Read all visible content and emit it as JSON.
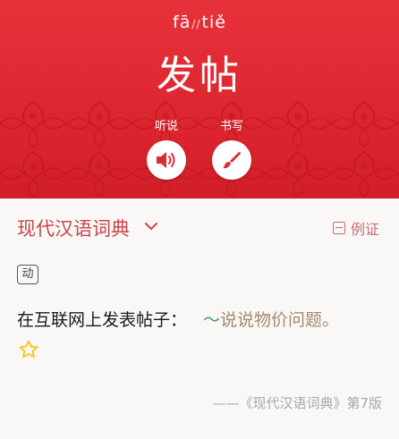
{
  "entry": {
    "pinyin_a": "fā",
    "pinyin_sep": "//",
    "pinyin_b": "tiě",
    "headword": "发帖"
  },
  "tools": {
    "listen_label": "听说",
    "write_label": "书写"
  },
  "source": {
    "name": "现代汉语词典",
    "example_toggle": "例证"
  },
  "definition": {
    "pos": "动",
    "text": "在互联网上发表帖子：",
    "tilde": "～",
    "example": "说说物价问题。"
  },
  "credit": "——《现代汉语词典》第7版",
  "colors": {
    "banner_red": "#e02a33",
    "source_red": "#c9444c",
    "tilde_green": "#3f9c67",
    "example_brown": "#a48a6e",
    "star_yellow": "#f5c518"
  }
}
